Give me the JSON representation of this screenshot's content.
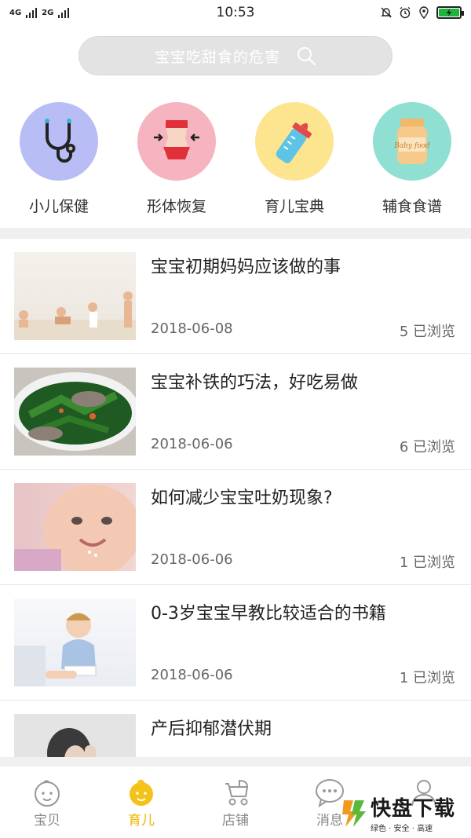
{
  "status_bar": {
    "network1": "4G",
    "network2": "2G",
    "time": "10:53"
  },
  "search": {
    "placeholder": "宝宝吃甜食的危害"
  },
  "categories": [
    {
      "label": "小儿保健",
      "icon": "stethoscope-icon",
      "color": "#b8bdf5"
    },
    {
      "label": "形体恢复",
      "icon": "body-shape-icon",
      "color": "#f6b3c0"
    },
    {
      "label": "育儿宝典",
      "icon": "baby-bottle-icon",
      "color": "#fde58f"
    },
    {
      "label": "辅食食谱",
      "icon": "baby-food-jar-icon",
      "color": "#8fe0d3"
    }
  ],
  "articles": [
    {
      "title": "宝宝初期妈妈应该做的事",
      "date": "2018-06-08",
      "views": "5 已浏览",
      "image": "baby-growth-stages"
    },
    {
      "title": "宝宝补铁的巧法，好吃易做",
      "date": "2018-06-06",
      "views": "6 已浏览",
      "image": "spinach-liver-soup"
    },
    {
      "title": "如何减少宝宝吐奶现象?",
      "date": "2018-06-06",
      "views": "1 已浏览",
      "image": "smiling-baby"
    },
    {
      "title": "0-3岁宝宝早教比较适合的书籍",
      "date": "2018-06-06",
      "views": "1 已浏览",
      "image": "baby-reading"
    },
    {
      "title": "产后抑郁潜伏期",
      "image": "sad-mother"
    }
  ],
  "tabs": [
    {
      "label": "宝贝",
      "icon": "baby-face-icon",
      "active": false
    },
    {
      "label": "育儿",
      "icon": "baby-face-filled-icon",
      "active": true
    },
    {
      "label": "店铺",
      "icon": "stroller-icon",
      "active": false
    },
    {
      "label": "消息",
      "icon": "chat-bubble-icon",
      "active": false
    },
    {
      "label": "",
      "icon": "person-icon",
      "active": false
    }
  ],
  "watermark": {
    "main": "快盘下载",
    "sub": "绿色 · 安全 · 高速"
  },
  "colors": {
    "accent": "#f0b400",
    "battery": "#1db53d"
  }
}
